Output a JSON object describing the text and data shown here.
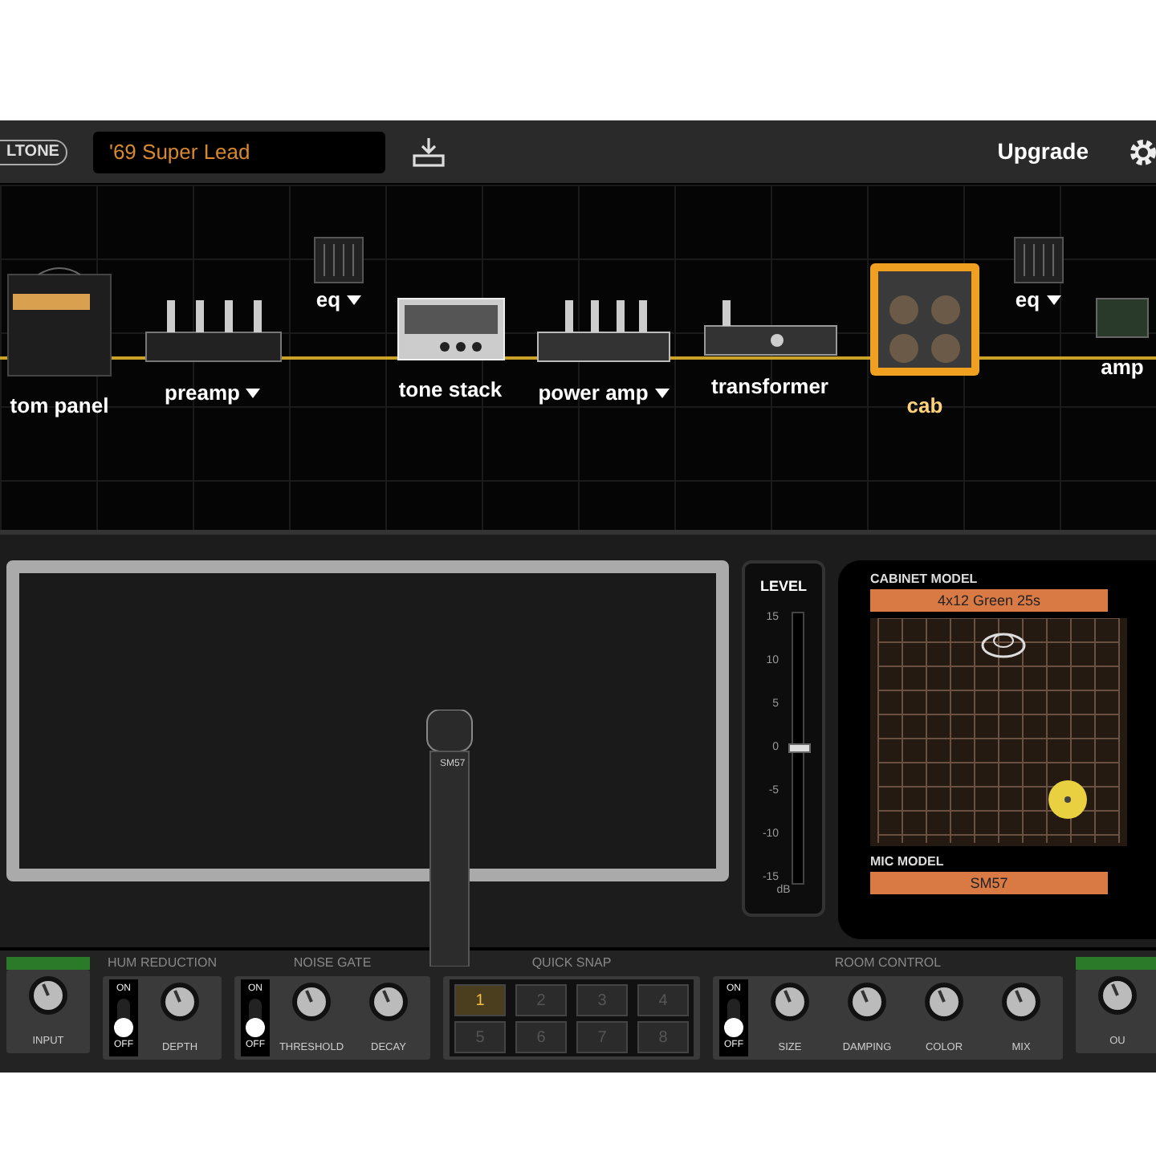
{
  "top_bar": {
    "logo": "LTONE",
    "preset": "'69 Super Lead",
    "upgrade": "Upgrade"
  },
  "chain": [
    {
      "kind": "amp",
      "label": "tom panel",
      "dropdown": false,
      "selected": false
    },
    {
      "kind": "preamp",
      "label": "preamp",
      "dropdown": true,
      "selected": false
    },
    {
      "kind": "eq",
      "label": "eq",
      "dropdown": true,
      "selected": false
    },
    {
      "kind": "tone",
      "label": "tone stack",
      "dropdown": false,
      "selected": false
    },
    {
      "kind": "power",
      "label": "power amp",
      "dropdown": true,
      "selected": false
    },
    {
      "kind": "transformer",
      "label": "transformer",
      "dropdown": false,
      "selected": false
    },
    {
      "kind": "cab",
      "label": "cab",
      "dropdown": false,
      "selected": true
    },
    {
      "kind": "eq",
      "label": "eq",
      "dropdown": true,
      "selected": false
    },
    {
      "kind": "rack",
      "label": "amp",
      "dropdown": false,
      "selected": false
    }
  ],
  "level": {
    "title": "LEVEL",
    "ticks": [
      "15",
      "10",
      "5",
      "0",
      "-5",
      "-10",
      "-15"
    ],
    "unit": "dB",
    "level": 0.5
  },
  "mic_label": "SM57",
  "cabinet_panel": {
    "cabinet_title": "CABINET MODEL",
    "cabinet_model": "4x12 Green 25s",
    "mic_title": "MIC MODEL",
    "mic_model": "SM57"
  },
  "bottom": [
    {
      "kind": "led",
      "controls": [
        {
          "kind": "knob",
          "label": "INPUT"
        }
      ]
    },
    {
      "kind": "titled",
      "title": "HUM REDUCTION",
      "controls": [
        {
          "kind": "switch",
          "on_label": "ON",
          "off_label": "OFF",
          "on": false
        },
        {
          "kind": "knob",
          "label": "DEPTH"
        }
      ]
    },
    {
      "kind": "titled",
      "title": "NOISE GATE",
      "controls": [
        {
          "kind": "switch",
          "on_label": "ON",
          "off_label": "OFF",
          "on": false
        },
        {
          "kind": "knob",
          "label": "THRESHOLD"
        },
        {
          "kind": "knob",
          "label": "DECAY"
        }
      ]
    },
    {
      "kind": "titled",
      "title": "QUICK SNAP",
      "controls": [
        {
          "kind": "snaps",
          "buttons": [
            {
              "label": "1",
              "selected": true
            },
            {
              "label": "2",
              "selected": false
            },
            {
              "label": "3",
              "selected": false
            },
            {
              "label": "4",
              "selected": false
            },
            {
              "label": "5",
              "selected": false
            },
            {
              "label": "6",
              "selected": false
            },
            {
              "label": "7",
              "selected": false
            },
            {
              "label": "8",
              "selected": false
            }
          ]
        }
      ]
    },
    {
      "kind": "titled",
      "title": "ROOM CONTROL",
      "controls": [
        {
          "kind": "switch",
          "on_label": "ON",
          "off_label": "OFF",
          "on": false
        },
        {
          "kind": "knob",
          "label": "SIZE"
        },
        {
          "kind": "knob",
          "label": "DAMPING"
        },
        {
          "kind": "knob",
          "label": "COLOR"
        },
        {
          "kind": "knob",
          "label": "MIX"
        }
      ]
    },
    {
      "kind": "led",
      "controls": [
        {
          "kind": "knob",
          "label": "OU"
        }
      ]
    }
  ]
}
